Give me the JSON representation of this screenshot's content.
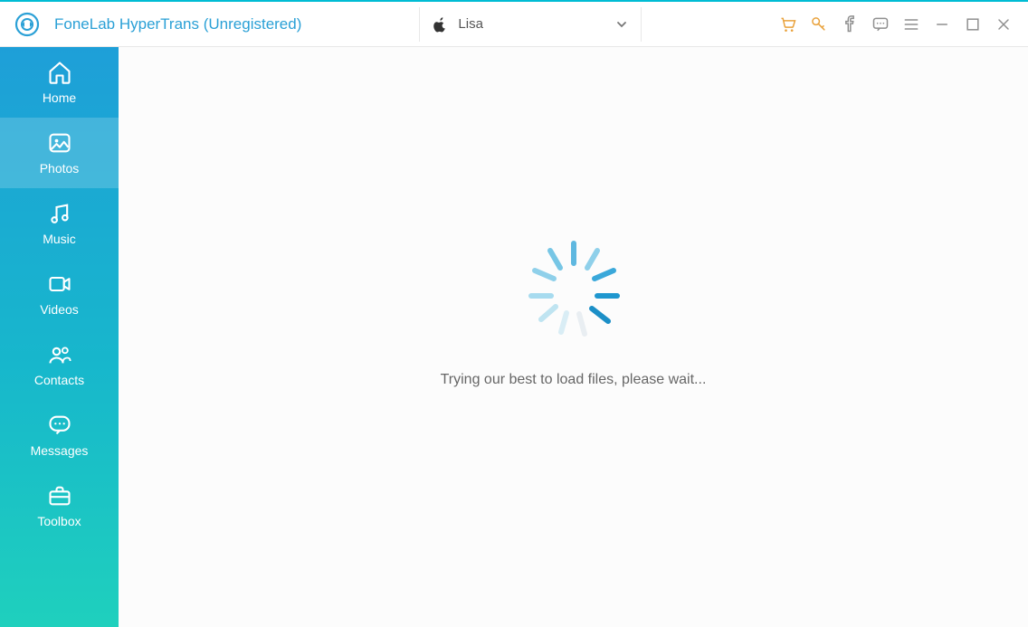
{
  "header": {
    "app_title": "FoneLab HyperTrans (Unregistered)"
  },
  "device": {
    "name": "Lisa",
    "platform_icon": "apple-icon"
  },
  "header_icons": {
    "cart": "cart-icon",
    "key": "key-icon",
    "facebook": "facebook-icon",
    "feedback": "feedback-icon",
    "menu": "menu-icon",
    "minimize": "minimize-icon",
    "maximize": "maximize-icon",
    "close": "close-icon"
  },
  "sidebar": {
    "items": [
      {
        "label": "Home",
        "icon": "home-icon"
      },
      {
        "label": "Photos",
        "icon": "photos-icon"
      },
      {
        "label": "Music",
        "icon": "music-icon"
      },
      {
        "label": "Videos",
        "icon": "videos-icon"
      },
      {
        "label": "Contacts",
        "icon": "contacts-icon"
      },
      {
        "label": "Messages",
        "icon": "messages-icon"
      },
      {
        "label": "Toolbox",
        "icon": "toolbox-icon"
      }
    ],
    "active_index": 1
  },
  "main": {
    "loading_text": "Trying our best to load files, please wait..."
  },
  "colors": {
    "accent": "#2aa0d6",
    "sidebar_top": "#1e9fd8",
    "sidebar_bottom": "#1fd0bd",
    "header_icon_warm": "#e9a23c"
  }
}
